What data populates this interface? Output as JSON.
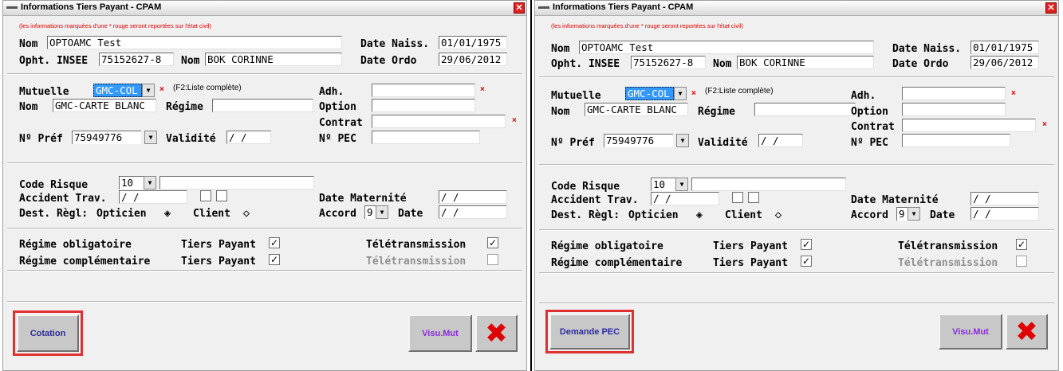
{
  "panels": [
    {
      "title": "Informations Tiers Payant - CPAM",
      "close_glyph": "✕",
      "note": "(les informations marquées d'une * rouge seront reportées sur l'état civil)",
      "header": {
        "nom_label": "Nom",
        "nom_value": "OPTOAMC Test",
        "date_naiss_label": "Date Naiss.",
        "date_naiss_value": "01/01/1975",
        "opht_label": "Opht. INSEE",
        "insee_value": "75152627-8",
        "nom2_label": "Nom",
        "nom2_value": "BOK CORINNE",
        "date_ordo_label": "Date Ordo",
        "date_ordo_value": "29/06/2012"
      },
      "mutuelle": {
        "mutuelle_label": "Mutuelle",
        "mutuelle_value": "GMC-COL",
        "required_mark": "×",
        "hint": "(F2:Liste complète)",
        "nom_label": "Nom",
        "nom_value": "GMC-CARTE BLANC",
        "regime_label": "Régime",
        "regime_value": "",
        "adh_label": "Adh.",
        "option_label": "Option",
        "contrat_label": "Contrat",
        "npref_label": "Nº Préf",
        "npref_value": "75949776",
        "validite_label": "Validité",
        "validite_value": " /  /",
        "npec_label": "Nº PEC"
      },
      "risque": {
        "code_risque_label": "Code Risque",
        "code_risque_value": "10",
        "accident_label": "Accident Trav.",
        "accident_value": " /  /",
        "date_maternite_label": "Date Maternité",
        "date_maternite_value": " /  /",
        "dest_label": "Dest. Règl:",
        "opticien_label": "Opticien",
        "client_label": "Client",
        "accord_label": "Accord",
        "accord_value": "9",
        "date_label": "Date",
        "date_value": " /  /"
      },
      "regimes": {
        "obligatoire_label": "Régime obligatoire",
        "complementaire_label": "Régime complémentaire",
        "tiers_payant_label": "Tiers Payant",
        "teletransmission_label": "Télétransmission",
        "check_glyph": "✓"
      },
      "buttons": {
        "action": "Cotation",
        "visu": "Visu.Mut",
        "cancel": "✖"
      }
    },
    {
      "title": "Informations Tiers Payant - CPAM",
      "close_glyph": "✕",
      "note": "(les informations marquées d'une * rouge seront reportées sur l'état civil)",
      "header": {
        "nom_label": "Nom",
        "nom_value": "OPTOAMC Test",
        "date_naiss_label": "Date Naiss.",
        "date_naiss_value": "01/01/1975",
        "opht_label": "Opht. INSEE",
        "insee_value": "75152627-8",
        "nom2_label": "Nom",
        "nom2_value": "BOK CORINNE",
        "date_ordo_label": "Date Ordo",
        "date_ordo_value": "29/06/2012"
      },
      "mutuelle": {
        "mutuelle_label": "Mutuelle",
        "mutuelle_value": "GMC-COL",
        "required_mark": "×",
        "hint": "(F2:Liste complète)",
        "nom_label": "Nom",
        "nom_value": "GMC-CARTE BLANC",
        "regime_label": "Régime",
        "regime_value": "",
        "adh_label": "Adh.",
        "option_label": "Option",
        "contrat_label": "Contrat",
        "npref_label": "Nº Préf",
        "npref_value": "75949776",
        "validite_label": "Validité",
        "validite_value": " /  /",
        "npec_label": "Nº PEC"
      },
      "risque": {
        "code_risque_label": "Code Risque",
        "code_risque_value": "10",
        "accident_label": "Accident Trav.",
        "accident_value": " /  /",
        "date_maternite_label": "Date Maternité",
        "date_maternite_value": " /  /",
        "dest_label": "Dest. Règl:",
        "opticien_label": "Opticien",
        "client_label": "Client",
        "accord_label": "Accord",
        "accord_value": "9",
        "date_label": "Date",
        "date_value": " /  /"
      },
      "regimes": {
        "obligatoire_label": "Régime obligatoire",
        "complementaire_label": "Régime complémentaire",
        "tiers_payant_label": "Tiers Payant",
        "teletransmission_label": "Télétransmission",
        "check_glyph": "✓"
      },
      "buttons": {
        "action": "Demande PEC",
        "visu": "Visu.Mut",
        "cancel": "✖"
      }
    }
  ]
}
